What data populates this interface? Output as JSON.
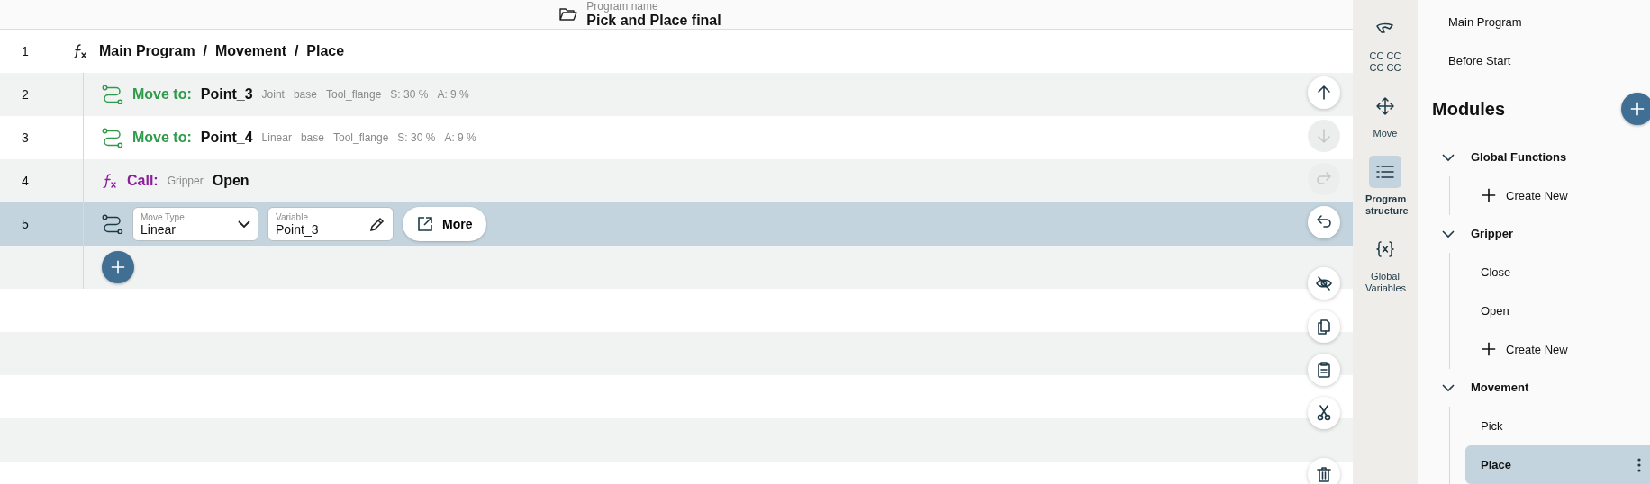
{
  "header": {
    "label": "Program name",
    "name": "Pick and Place final"
  },
  "lines": [
    {
      "number": "1",
      "kind": "breadcrumb",
      "text": "Main Program  /  Movement  /  Place",
      "selected": false
    },
    {
      "number": "2",
      "kind": "move",
      "keyword": "Move to:",
      "target": "Point_3",
      "params": [
        "Joint",
        "base",
        "Tool_flange",
        "S: 30 %",
        "A: 9 %"
      ],
      "selected": false
    },
    {
      "number": "3",
      "kind": "move",
      "keyword": "Move to:",
      "target": "Point_4",
      "params": [
        "Linear",
        "base",
        "Tool_flange",
        "S: 30 %",
        "A: 9 %"
      ],
      "selected": false
    },
    {
      "number": "4",
      "kind": "call",
      "keyword": "Call:",
      "module": "Gripper",
      "target": "Open",
      "selected": false
    },
    {
      "number": "5",
      "kind": "edit",
      "move_type": {
        "label": "Move Type",
        "value": "Linear"
      },
      "variable": {
        "label": "Variable",
        "value": "Point_3"
      },
      "more": "More",
      "selected": true
    }
  ],
  "action_groups": [
    [
      {
        "kind": "up",
        "disabled": false
      },
      {
        "kind": "down",
        "disabled": true
      },
      {
        "kind": "redo",
        "disabled": true
      },
      {
        "kind": "undo",
        "disabled": false
      }
    ],
    [
      {
        "kind": "hide",
        "disabled": false
      },
      {
        "kind": "copy",
        "disabled": false
      },
      {
        "kind": "paste",
        "disabled": false
      },
      {
        "kind": "cut",
        "disabled": false
      }
    ],
    [
      {
        "kind": "delete",
        "disabled": false
      }
    ]
  ],
  "rail": [
    {
      "kind": "gripper",
      "label": "CC CC CC CC",
      "selected": false
    },
    {
      "kind": "move",
      "label": "Move",
      "selected": false
    },
    {
      "kind": "structure",
      "label": "Program structure",
      "selected": true
    },
    {
      "kind": "variables",
      "label": "Global Variables",
      "selected": false
    }
  ],
  "sidebar": {
    "items": [
      {
        "label": "Main Program",
        "selected": false
      },
      {
        "label": "Before Start",
        "selected": false
      }
    ],
    "modules_title": "Modules",
    "groups": [
      {
        "title": "Global Functions",
        "expanded": true,
        "children": [
          {
            "kind": "create",
            "label": "Create New",
            "selected": false
          }
        ]
      },
      {
        "title": "Gripper",
        "expanded": true,
        "children": [
          {
            "kind": "item",
            "label": "Close",
            "selected": false
          },
          {
            "kind": "item",
            "label": "Open",
            "selected": false
          },
          {
            "kind": "create",
            "label": "Create New",
            "selected": false
          }
        ]
      },
      {
        "title": "Movement",
        "expanded": true,
        "children": [
          {
            "kind": "item",
            "label": "Pick",
            "selected": false
          },
          {
            "kind": "item",
            "label": "Place",
            "selected": true
          }
        ]
      }
    ]
  }
}
